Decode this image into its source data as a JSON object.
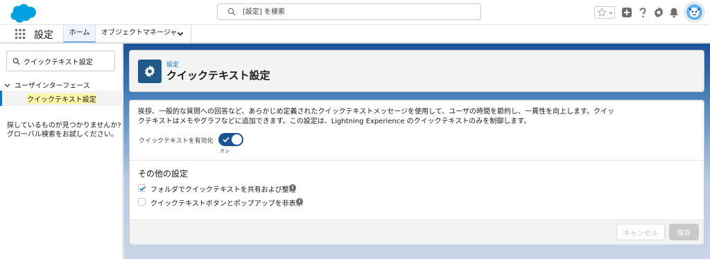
{
  "header": {
    "search_placeholder": "[設定] を検索",
    "brand_color": "#00a1e0"
  },
  "context_bar": {
    "app_name": "設定",
    "tabs": [
      {
        "label": "ホーム",
        "active": true
      },
      {
        "label": "オブジェクトマネージャ",
        "has_dropdown": true
      }
    ]
  },
  "sidebar": {
    "quick_find_value": "クイックテキスト設定",
    "tree_parent": "ユーザインターフェース",
    "tree_child": "クイックテキスト設定",
    "help_text": "探しているものが見つかりませんか? グローバル検索をお試しください。"
  },
  "page_header": {
    "subtitle": "設定",
    "title": "クイックテキスト設定"
  },
  "card": {
    "description": "挨拶、一般的な質問への回答など、あらかじめ定義されたクイックテキストメッセージを使用して、ユーザの時間を節約し、一貫性を向上します。クイックテキストはメモやグラフなどに追加できます。この設定は、Lightning Experience のクイックテキストのみを制御します。",
    "toggle_label": "クイックテキストを有効化",
    "toggle_state": "オン",
    "section_title": "その他の設定",
    "options": [
      {
        "label": "フォルダでクイックテキストを共有および整理",
        "checked": true
      },
      {
        "label": "クイックテキストボタンとポップアップを非表示",
        "checked": false
      }
    ],
    "info_glyph": "i",
    "cancel_label": "キャンセル",
    "save_label": "保存"
  }
}
